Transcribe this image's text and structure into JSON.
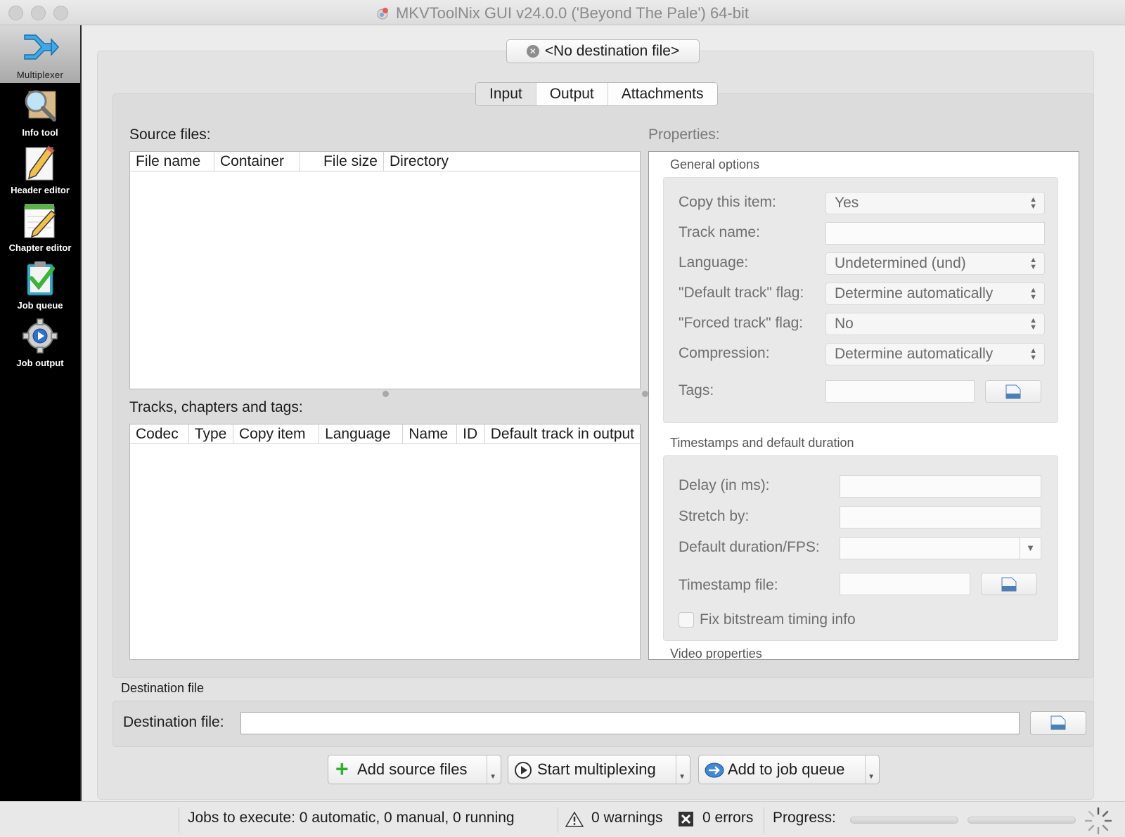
{
  "window": {
    "title": "MKVToolNix GUI v24.0.0 ('Beyond The Pale') 64-bit"
  },
  "sidebar": {
    "items": [
      {
        "label": "Multiplexer",
        "icon": "multiplexer-icon",
        "active": true
      },
      {
        "label": "Info tool",
        "icon": "magnifier-icon"
      },
      {
        "label": "Header editor",
        "icon": "pencil-paper-icon"
      },
      {
        "label": "Chapter editor",
        "icon": "notepad-pencil-icon"
      },
      {
        "label": "Job queue",
        "icon": "clipboard-check-icon"
      },
      {
        "label": "Job output",
        "icon": "gear-play-icon"
      }
    ]
  },
  "header": {
    "destination_button": "<No destination file>"
  },
  "tabs": [
    {
      "label": "Input",
      "selected": true
    },
    {
      "label": "Output"
    },
    {
      "label": "Attachments"
    }
  ],
  "input": {
    "source_files_label": "Source files:",
    "source_columns": [
      "File name",
      "Container",
      "File size",
      "Directory"
    ],
    "tracks_label": "Tracks, chapters and tags:",
    "track_columns": [
      "Codec",
      "Type",
      "Copy item",
      "Language",
      "Name",
      "ID",
      "Default track in output"
    ]
  },
  "properties": {
    "label": "Properties:",
    "general": {
      "title": "General options",
      "copy_item_label": "Copy this item:",
      "copy_item_value": "Yes",
      "track_name_label": "Track name:",
      "language_label": "Language:",
      "language_value": "Undetermined (und)",
      "default_flag_label": "\"Default track\" flag:",
      "default_flag_value": "Determine automatically",
      "forced_flag_label": "\"Forced track\" flag:",
      "forced_flag_value": "No",
      "compression_label": "Compression:",
      "compression_value": "Determine automatically",
      "tags_label": "Tags:"
    },
    "timestamps": {
      "title": "Timestamps and default duration",
      "delay_label": "Delay (in ms):",
      "stretch_label": "Stretch by:",
      "duration_label": "Default duration/FPS:",
      "timestamp_file_label": "Timestamp file:",
      "fix_bitstream_label": "Fix bitstream timing info"
    },
    "video": {
      "title": "Video properties"
    }
  },
  "destination": {
    "group_title": "Destination file",
    "label": "Destination file:"
  },
  "actions": {
    "add_source": "Add source files",
    "start_mux": "Start multiplexing",
    "add_queue": "Add to job queue"
  },
  "status": {
    "jobs": "Jobs to execute:  0 automatic, 0 manual, 0 running",
    "warnings": "0 warnings",
    "errors": "0 errors",
    "progress": "Progress:"
  }
}
